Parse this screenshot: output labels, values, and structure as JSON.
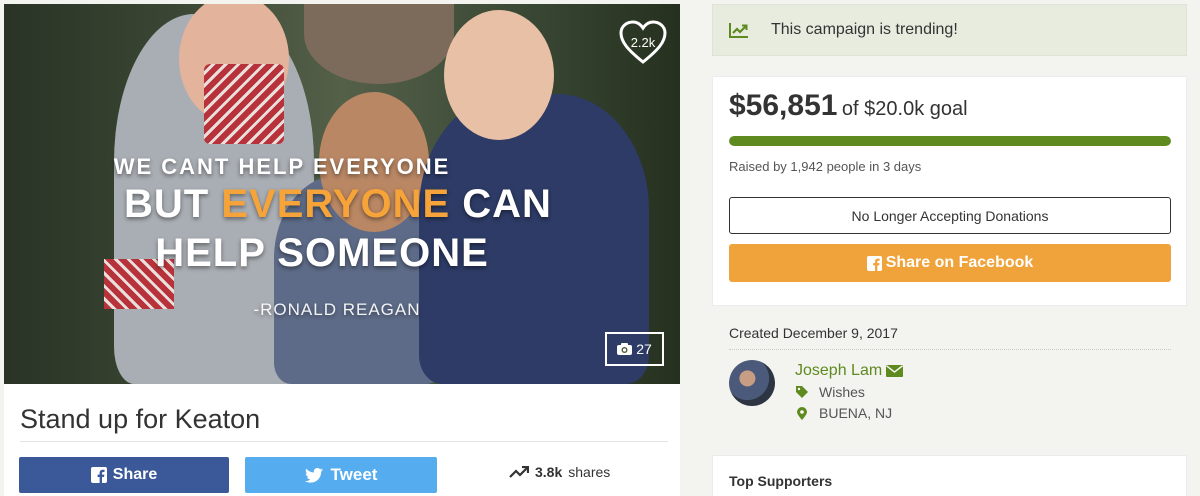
{
  "hero": {
    "quote_line1": "WE CANT HELP EVERYONE",
    "quote_line2_pre": "BUT ",
    "quote_line2_highlight": "EVERYONE",
    "quote_line2_post": " CAN",
    "quote_line3": "HELP SOMEONE",
    "quote_attribution": "-RONALD REAGAN",
    "hearts_count": "2.2k",
    "photo_count": "27",
    "highlight_color": "#f6a43a"
  },
  "campaign": {
    "title": "Stand up for Keaton",
    "share_facebook_label": "Share",
    "tweet_label": "Tweet",
    "shares_count": "3.8k",
    "shares_label": "shares"
  },
  "trending": {
    "text": "This campaign is trending!",
    "icon": "trending-up-icon"
  },
  "donations": {
    "raised_amount": "$56,851",
    "goal_text": "of $20.0k goal",
    "progress_percent": 100,
    "raised_summary": "Raised by 1,942 people in 3 days",
    "closed_button_label": "No Longer Accepting Donations",
    "share_button_label": "Share on Facebook",
    "progress_color": "#5e8a1f",
    "share_button_color": "#f0a33a"
  },
  "organizer": {
    "created": "Created December 9, 2017",
    "name": "Joseph Lam",
    "category": "Wishes",
    "location": "BUENA, NJ"
  },
  "supporters": {
    "heading": "Top Supporters"
  },
  "colors": {
    "facebook": "#3b5998",
    "twitter": "#55acee",
    "brand_green": "#5e8a1f",
    "trending_bg": "#e8ecdf"
  }
}
